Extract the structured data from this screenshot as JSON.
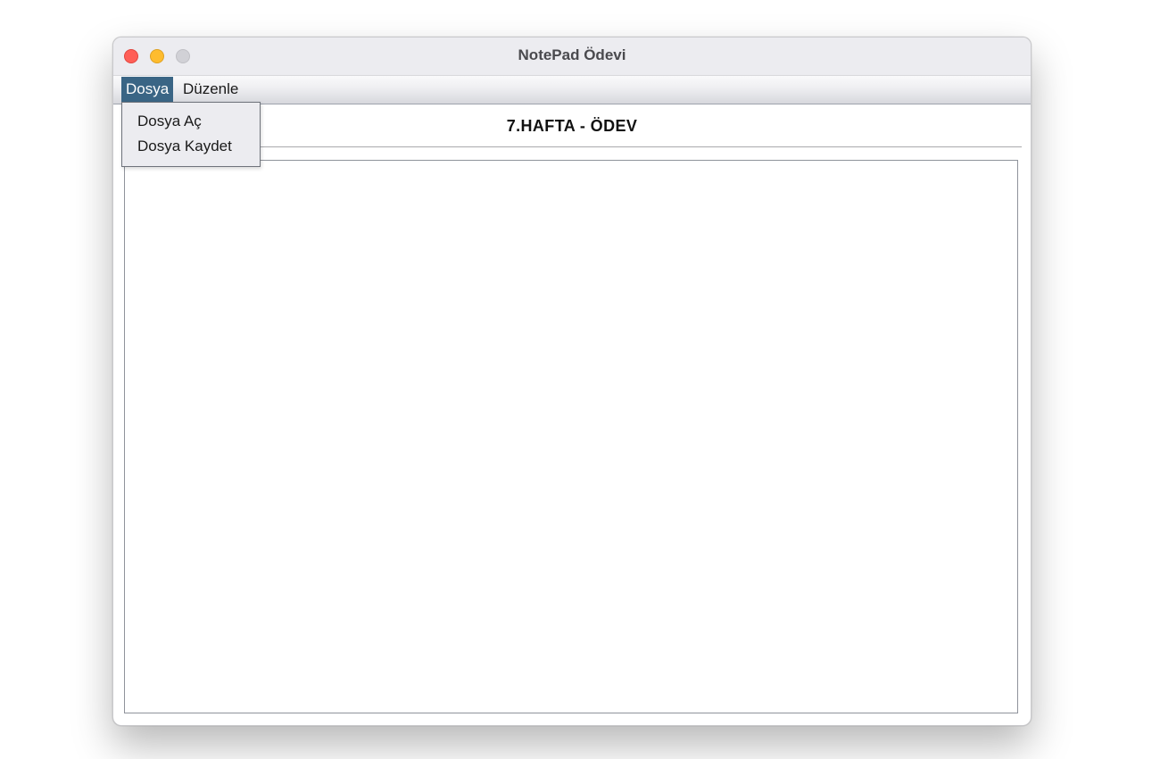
{
  "window": {
    "title": "NotePad Ödevi"
  },
  "menubar": {
    "items": [
      {
        "label": "Dosya",
        "active": true
      },
      {
        "label": "Düzenle",
        "active": false
      }
    ]
  },
  "file_menu": {
    "items": [
      {
        "label": "Dosya Aç"
      },
      {
        "label": "Dosya Kaydet"
      }
    ]
  },
  "content": {
    "header": "7.HAFTA - ÖDEV",
    "text": ""
  },
  "colors": {
    "close": "#ff5f57",
    "minimize": "#febc2e",
    "zoom": "#d1d1d6",
    "menu_active": "#3a6585"
  },
  "icons": [
    "close-icon",
    "minimize-icon",
    "zoom-icon"
  ]
}
